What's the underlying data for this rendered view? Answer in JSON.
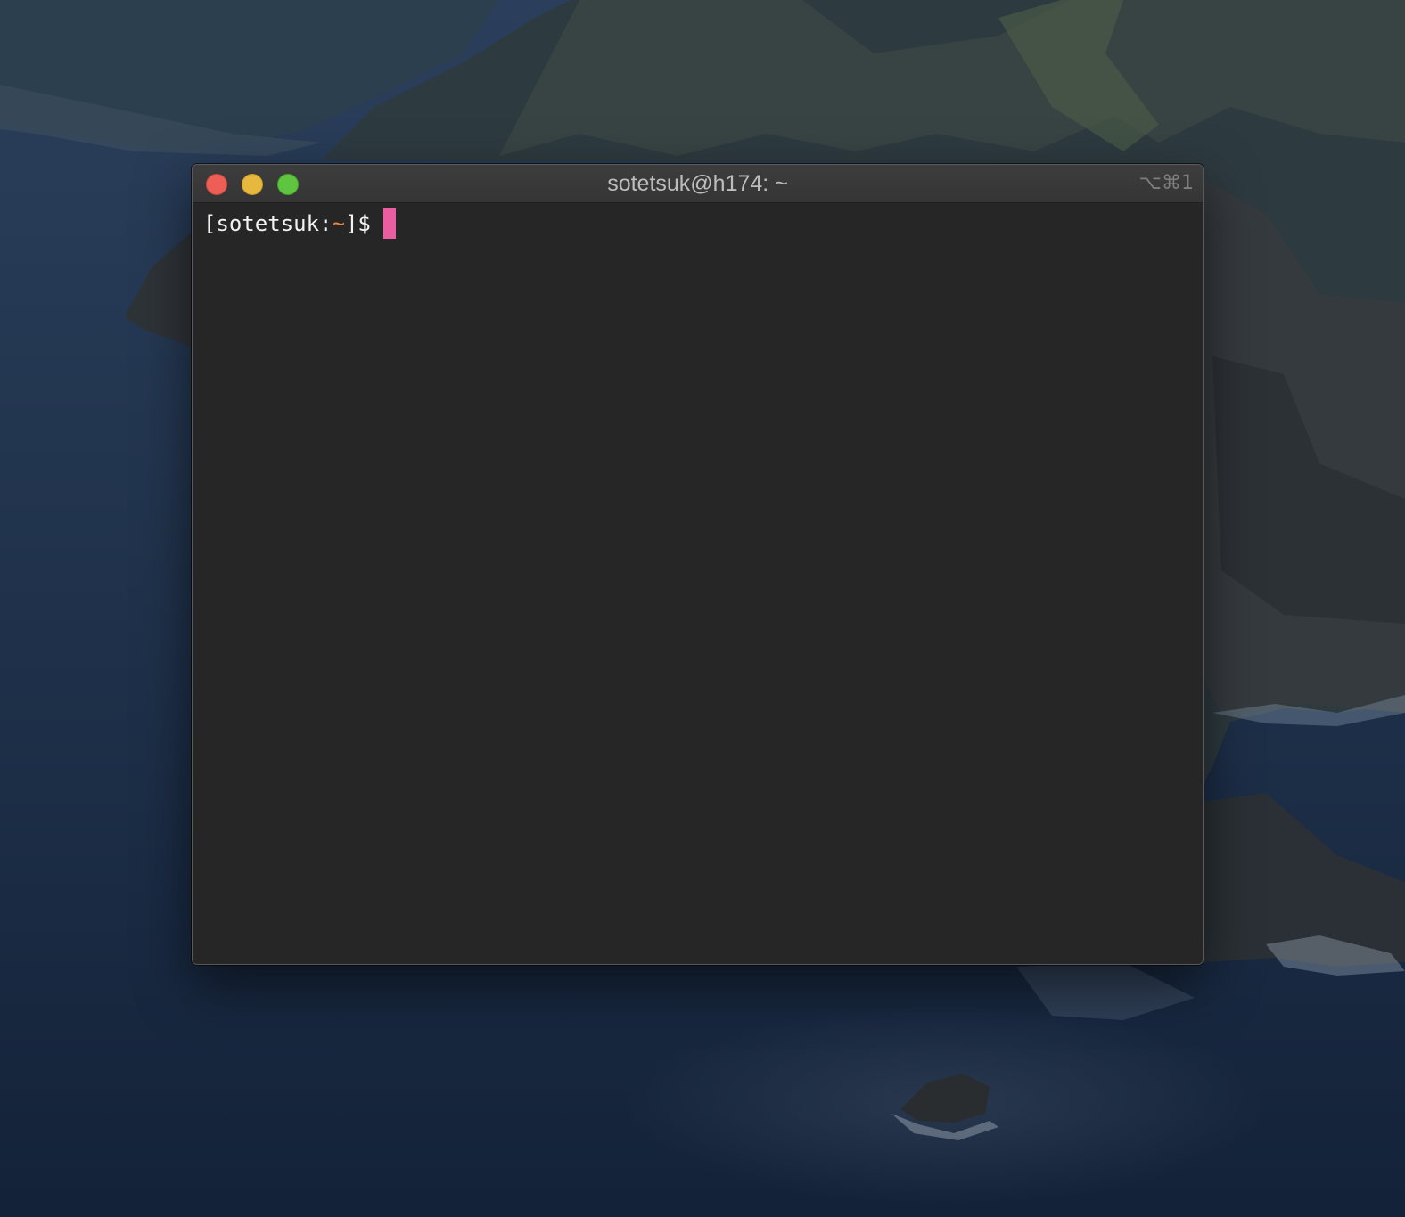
{
  "desktop": {
    "wallpaper": "coastal-cliffs-dark"
  },
  "window": {
    "title": "sotetsuk@h174: ~",
    "shortcut": "⌥⌘1",
    "traffic_lights": {
      "close_color": "#ed5e56",
      "minimize_color": "#e6b83f",
      "zoom_color": "#5fc43f"
    }
  },
  "terminal": {
    "prompt": {
      "open_bracket": "[",
      "user": "sotetsuk",
      "colon": ":",
      "path": "~",
      "close_bracket": "]",
      "dollar": "$"
    },
    "input": "",
    "cursor_color": "#e85ea0",
    "path_color": "#e8863c",
    "background": "#262626"
  }
}
